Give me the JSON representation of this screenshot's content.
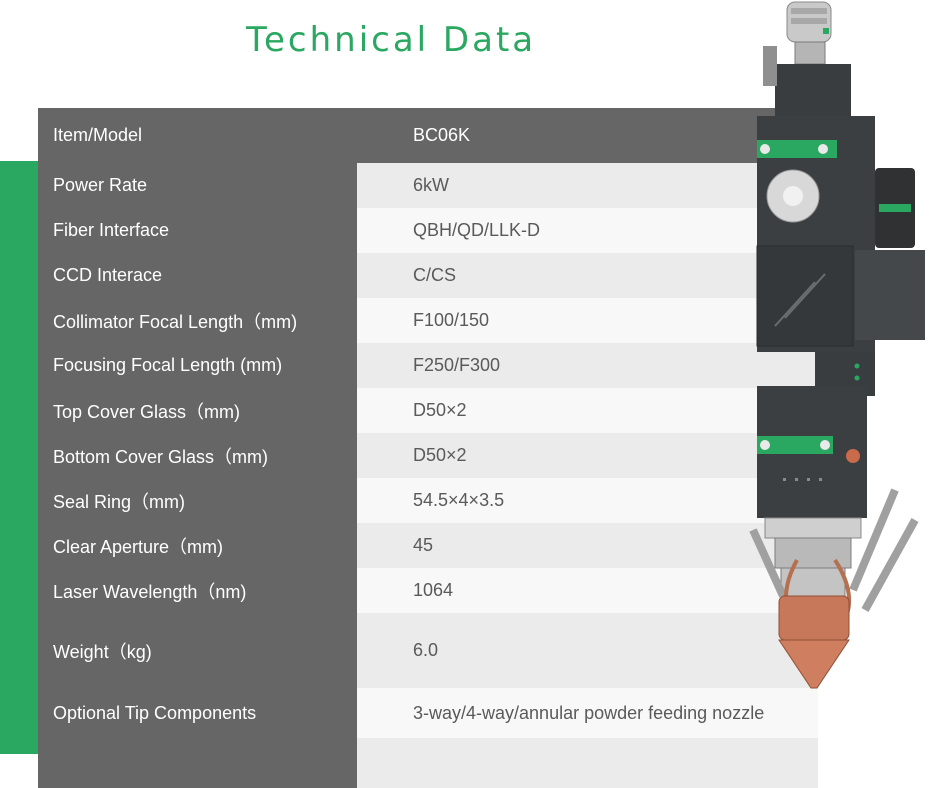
{
  "title": "Technical Data",
  "colors": {
    "accent": "#2aa760",
    "label_bg": "#666666",
    "row_alt": "#ebebeb"
  },
  "table": {
    "header": {
      "label": "Item/Model",
      "value": "BC06K"
    },
    "rows": [
      {
        "label": "Power Rate",
        "value": "6kW"
      },
      {
        "label": "Fiber Interface",
        "value": "QBH/QD/LLK-D"
      },
      {
        "label": "CCD Interace",
        "value": "C/CS"
      },
      {
        "label": "Collimator Focal Length（mm)",
        "value": "F100/150"
      },
      {
        "label": "Focusing Focal Length (mm)",
        "value": "F250/F300"
      },
      {
        "label": "Top Cover Glass（mm)",
        "value": "D50×2"
      },
      {
        "label": "Bottom Cover Glass（mm)",
        "value": "D50×2"
      },
      {
        "label": "Seal Ring（mm)",
        "value": "54.5×4×3.5"
      },
      {
        "label": "Clear Aperture（mm)",
        "value": "45"
      },
      {
        "label": "Laser Wavelength（nm)",
        "value": "1064"
      },
      {
        "label": "Weight（kg)",
        "value": "6.0"
      },
      {
        "label": "Optional Tip Components",
        "value": "3-way/4-way/annular powder feeding nozzle"
      }
    ]
  }
}
